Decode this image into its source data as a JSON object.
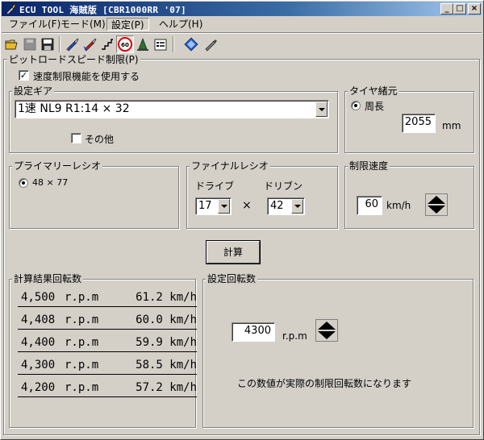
{
  "window": {
    "title": "ECU TOOL 海賊版 [CBR1000RR '07]",
    "controls": [
      "_",
      "□",
      "×"
    ]
  },
  "menu": [
    {
      "label": "ファイル(F)",
      "active": false
    },
    {
      "label": "モード(M)",
      "active": false
    },
    {
      "label": "設定(P)",
      "active": true
    },
    {
      "label": "ヘルプ(H)",
      "active": false
    }
  ],
  "toolbar": {
    "icons": [
      "folder-open-icon",
      "disk-gray-icon",
      "save-icon",
      "brush-blue-icon",
      "brush-red-icon",
      "staircase-icon",
      "speed-limit-60-icon",
      "cone-icon",
      "properties-icon",
      "blue-diamond-icon",
      "pencil-icon"
    ],
    "speed_sign": "60"
  },
  "main_group": {
    "label": "ピットロードスピード制限(P)",
    "enable_check": {
      "label": "速度制限機能を使用する",
      "checked": true
    }
  },
  "gear": {
    "label": "設定ギア",
    "selected": "1速 NL9 R1:14 × 32",
    "other": {
      "label": "その他",
      "checked": false
    }
  },
  "tire": {
    "label": "タイヤ緒元",
    "radio_label": "周長",
    "value": "2055",
    "unit": "mm"
  },
  "primary": {
    "label": "プライマリーレシオ",
    "radio_label": "48 × 77"
  },
  "final": {
    "label": "ファイナルレシオ",
    "drive_label": "ドライブ",
    "driven_label": "ドリブン",
    "drive_value": "17",
    "driven_value": "42",
    "times": "×"
  },
  "limit_speed": {
    "label": "制限速度",
    "value": "60",
    "unit": "km/h"
  },
  "calc_button": "計算",
  "results": {
    "label": "計算結果回転数",
    "rpm_unit": "r.p.m",
    "rows": [
      {
        "rpm": "4,500",
        "speed": "61.2 km/h"
      },
      {
        "rpm": "4,408",
        "speed": "60.0 km/h"
      },
      {
        "rpm": "4,400",
        "speed": "59.9 km/h"
      },
      {
        "rpm": "4,300",
        "speed": "58.5 km/h"
      },
      {
        "rpm": "4,200",
        "speed": "57.2 km/h"
      }
    ]
  },
  "setting_rpm": {
    "label": "設定回転数",
    "value": "4300",
    "unit": "r.p.m",
    "note": "この数値が実際の制限回転数になります"
  }
}
